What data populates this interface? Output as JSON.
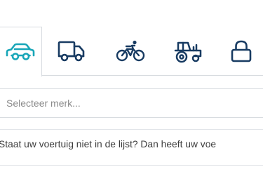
{
  "colors": {
    "accent": "#18a6b8",
    "icon": "#183b62",
    "border": "#d7dbe0",
    "text": "#3d3d3d",
    "placeholder": "#8b8b8b",
    "background": "#ffffff"
  },
  "vehicle_tabs": [
    {
      "icon": "car-icon",
      "active": true
    },
    {
      "icon": "truck-icon",
      "active": false
    },
    {
      "icon": "bicycle-icon",
      "active": false
    },
    {
      "icon": "tractor-icon",
      "active": false
    },
    {
      "icon": "lock-icon",
      "active": false
    }
  ],
  "search": {
    "placeholder": "Selecteer merk...",
    "value": ""
  },
  "notice": {
    "text": "Staat uw voertuig niet in de lijst? Dan heeft uw voe"
  }
}
